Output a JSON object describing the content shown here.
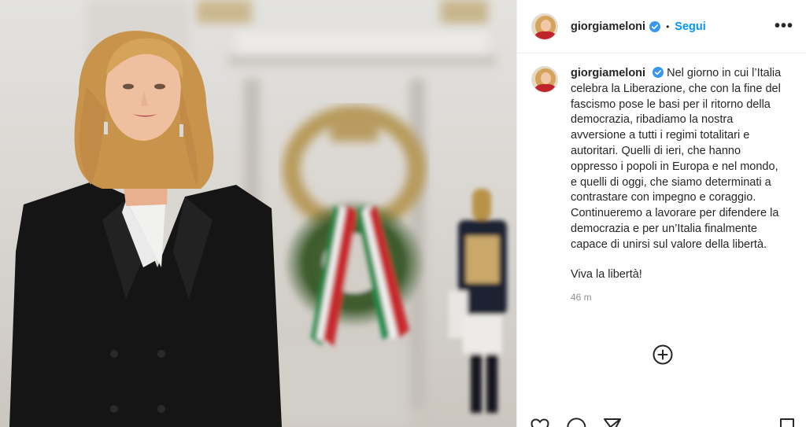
{
  "post": {
    "username": "giorgiameloni",
    "follow_label": "Segui",
    "separator": "•",
    "more_label": "•••",
    "caption": "Nel giorno in cui l’Italia celebra la Liberazione, che con la fine del fascismo pose le basi per il ritorno della democrazia, ribadiamo la nostra avversione a tutti i regimi totalitari e autoritari. Quelli di ieri, che hanno oppresso i popoli in Europa e nel mondo, e quelli di oggi, che siamo determinati a contrastare con impegno e coraggio. Continueremo a lavorare per difendere la democrazia e per un’Italia finalmente capace di unirsi sul valore della libertà.",
    "caption_closing": "Viva la libertà!",
    "timestamp": "46 m"
  },
  "icons": {
    "verified": "verified-badge-icon",
    "more": "more-options-icon",
    "add": "add-comment-icon",
    "like": "heart-icon",
    "comment": "comment-icon",
    "share": "share-icon",
    "save": "bookmark-icon"
  },
  "colors": {
    "link_blue": "#0095f6",
    "verified_blue": "#3897f0",
    "text": "#262626",
    "muted": "#8e8e8e"
  }
}
